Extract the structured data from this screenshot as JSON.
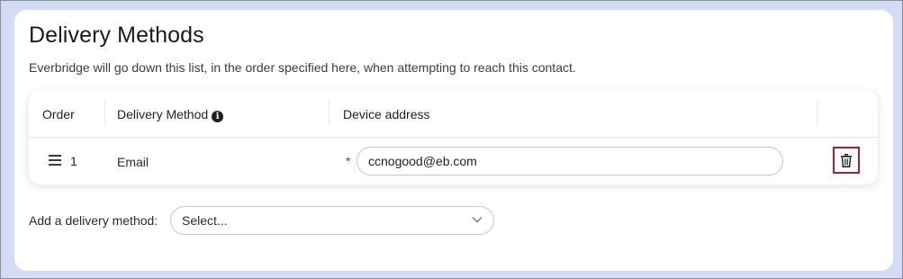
{
  "section": {
    "title": "Delivery Methods",
    "subtitle": "Everbridge will go down this list, in the order specified here, when attempting to reach this contact."
  },
  "table": {
    "columns": {
      "order": "Order",
      "delivery_method": "Delivery Method",
      "device_address": "Device address"
    },
    "rows": [
      {
        "order": "1",
        "method": "Email",
        "required_mark": "*",
        "address": "ccnogood@eb.com"
      }
    ]
  },
  "add_method": {
    "label": "Add a delivery method:",
    "select_value": "Select..."
  },
  "icons": {
    "info": "info-icon",
    "drag": "drag-handle-icon",
    "delete": "trash-icon",
    "chevron": "chevron-down-icon"
  },
  "colors": {
    "background": "#d3dcf6",
    "delete_border": "#a8202f",
    "required": "#b3261e"
  }
}
